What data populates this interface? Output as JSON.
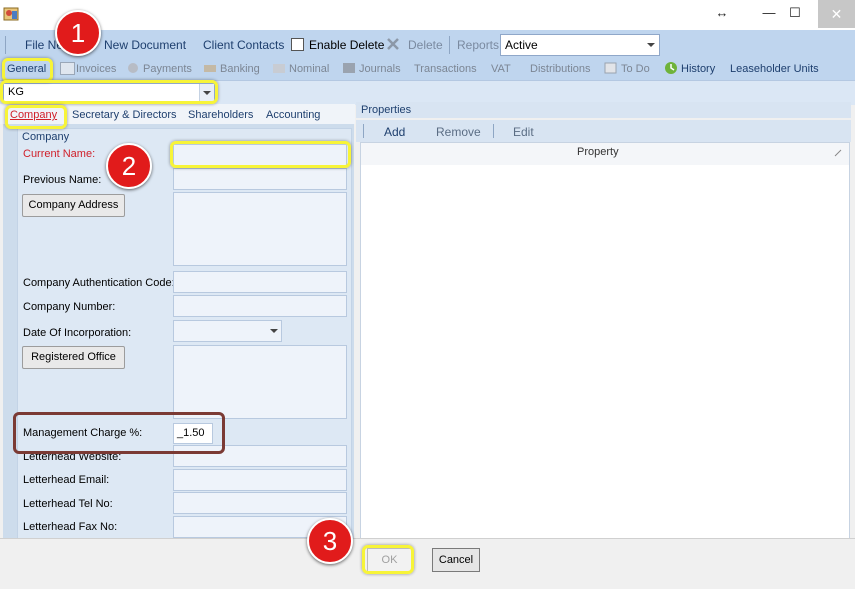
{
  "window": {
    "resize_glyph": "↔",
    "minimize_glyph": "—",
    "maximize_glyph": "☐",
    "close_glyph": "✕"
  },
  "toolbar": {
    "file_label": "File Ne",
    "new_document": "New Document",
    "client_contacts": "Client Contacts",
    "enable_delete": "Enable Delete",
    "delete": "Delete",
    "reports": "Reports",
    "status_value": "Active"
  },
  "nav": {
    "items": [
      "General",
      "Invoices",
      "Payments",
      "Banking",
      "Nominal",
      "Journals",
      "Transactions",
      "VAT",
      "Distributions",
      "To Do",
      "History",
      "Leaseholder Units"
    ]
  },
  "client_select": {
    "value": "KG"
  },
  "subtabs": [
    "Company",
    "Secretary & Directors",
    "Shareholders",
    "Accounting"
  ],
  "company": {
    "group_label": "Company",
    "current_name_label": "Current Name:",
    "previous_name_label": "Previous Name:",
    "company_address_button": "Company Address",
    "auth_code_label": "Company Authentication Code:",
    "company_number_label": "Company Number:",
    "date_incorporation_label": "Date Of Incorporation:",
    "registered_office_button": "Registered Office",
    "management_charge_label": "Management Charge %:",
    "management_charge_value": "_1.50",
    "letterhead_website_label": "Letterhead Website:",
    "letterhead_email_label": "Letterhead Email:",
    "letterhead_tel_label": "Letterhead Tel No:",
    "letterhead_fax_label": "Letterhead Fax No:"
  },
  "properties": {
    "title": "Properties",
    "add": "Add",
    "remove": "Remove",
    "edit": "Edit",
    "column_property": "Property"
  },
  "footer": {
    "ok": "OK",
    "cancel": "Cancel"
  },
  "markers": [
    "1",
    "2",
    "3"
  ],
  "colors": {
    "marker_red": "#e11b1b",
    "highlight_yellow": "#f7f438",
    "highlight_brown": "#7b3a34",
    "required_red": "#d0202a"
  }
}
